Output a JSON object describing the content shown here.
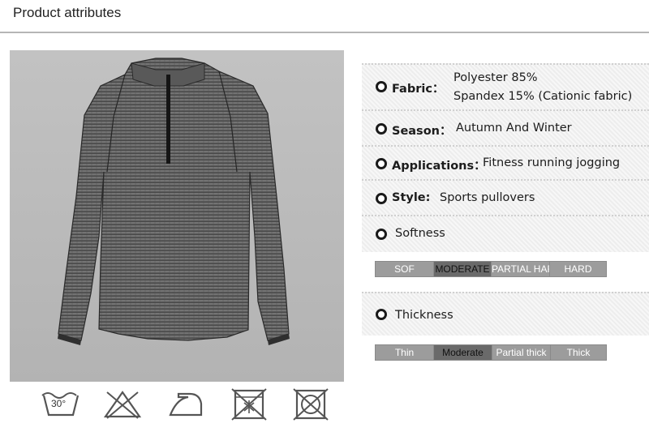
{
  "header": {
    "title": "Product attributes"
  },
  "attributes": {
    "fabric": {
      "label": "Fabric：",
      "value_line1": "Polyester 85%",
      "value_line2": "Spandex 15% (Cationic fabric)"
    },
    "season": {
      "label": "Season：",
      "value": "Autumn And Winter"
    },
    "applications": {
      "label": "Applications：",
      "value": "Fitness running jogging"
    },
    "style": {
      "label": "Style:",
      "value": "Sports pullovers"
    },
    "softness": {
      "label": "Softness",
      "scale": [
        {
          "label": "SOF",
          "selected": false
        },
        {
          "label": "MODERATE",
          "selected": true
        },
        {
          "label": "PARTIAL HARD",
          "selected": false
        },
        {
          "label": "HARD",
          "selected": false
        }
      ]
    },
    "thickness": {
      "label": "Thickness",
      "scale": [
        {
          "label": "Thin",
          "selected": false
        },
        {
          "label": "Moderate",
          "selected": true
        },
        {
          "label": "Partial thick",
          "selected": false
        },
        {
          "label": "Thick",
          "selected": false
        }
      ]
    }
  },
  "care_icons": [
    {
      "icon": "wash-30-icon",
      "text": "30°"
    },
    {
      "icon": "no-bleach-icon"
    },
    {
      "icon": "iron-icon"
    },
    {
      "icon": "no-tumble-dry-icon"
    },
    {
      "icon": "no-dry-clean-icon"
    }
  ],
  "colors": {
    "scale_selected": "#6a6a6a",
    "scale_default": "#9c9c9c",
    "scale_text_selected": "#111111",
    "scale_text_default": "#ffffff",
    "shirt": "#5a5a5a"
  }
}
